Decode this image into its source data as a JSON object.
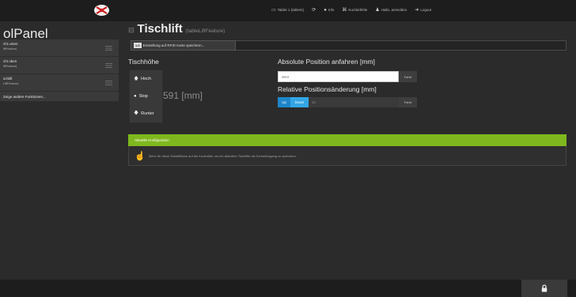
{
  "topnav": {
    "items": [
      {
        "icon": "monitor-icon",
        "glyph": "▭",
        "label": "Tablet 1 (tablet1)"
      },
      {
        "icon": "refresh-icon",
        "glyph": "⟳",
        "label": ""
      },
      {
        "icon": "info-icon",
        "glyph": "●",
        "label": "Info"
      },
      {
        "icon": "shortcuts-icon",
        "glyph": "⌘",
        "label": "Kurzbefehle"
      },
      {
        "icon": "user-icon",
        "glyph": "♟",
        "label": "Hallo, anmelden"
      },
      {
        "icon": "logout-icon",
        "glyph": "➜",
        "label": "Logout"
      }
    ]
  },
  "sidebar": {
    "title": "olPanel",
    "items": [
      {
        "label": "cht unten",
        "sublabel": "iftFeature)"
      },
      {
        "label": "cht oben",
        "sublabel": "iftFeature)"
      },
      {
        "label": "schlift",
        "sublabel": "LiftFeature)"
      }
    ],
    "more_label": "Zeige andere Funktionen..."
  },
  "main": {
    "title": "Tischlift",
    "subtitle": "(tableLiftFeature)",
    "save_badge": "1.0",
    "save_label": "Einstellung auf RFID Karte speichern..."
  },
  "height": {
    "heading": "Tischhöhe",
    "value": "591 [mm]",
    "buttons": [
      {
        "icon": "arrow-up-icon",
        "glyph": "🡅",
        "label": "Hoch"
      },
      {
        "icon": "stop-icon",
        "glyph": "●",
        "label": "Stop"
      },
      {
        "icon": "arrow-down-icon",
        "glyph": "🡇",
        "label": "Runter"
      }
    ]
  },
  "absolute": {
    "heading": "Absolute Position anfahren [mm]",
    "placeholder": "Wert",
    "button": "Fahrt"
  },
  "relative": {
    "heading": "Relative Positionsänderung [mm]",
    "up_label": "Up",
    "down_label": "Down",
    "value": "10",
    "button": "Fahrt"
  },
  "notice": {
    "header": "Aktuelle Konfiguration",
    "icon": "hand-pointer-icon",
    "text": "Ziehe für diese Schaltfläche auf die Kontrolltür um ein aktuellen Tischlifte als Schnellzugang zu speichern."
  },
  "footer": {
    "icon": "lock-icon"
  },
  "colors": {
    "accent_green": "#7fb81e",
    "accent_blue": "#1d86c9",
    "accent_blue_light": "#33a6e6"
  }
}
